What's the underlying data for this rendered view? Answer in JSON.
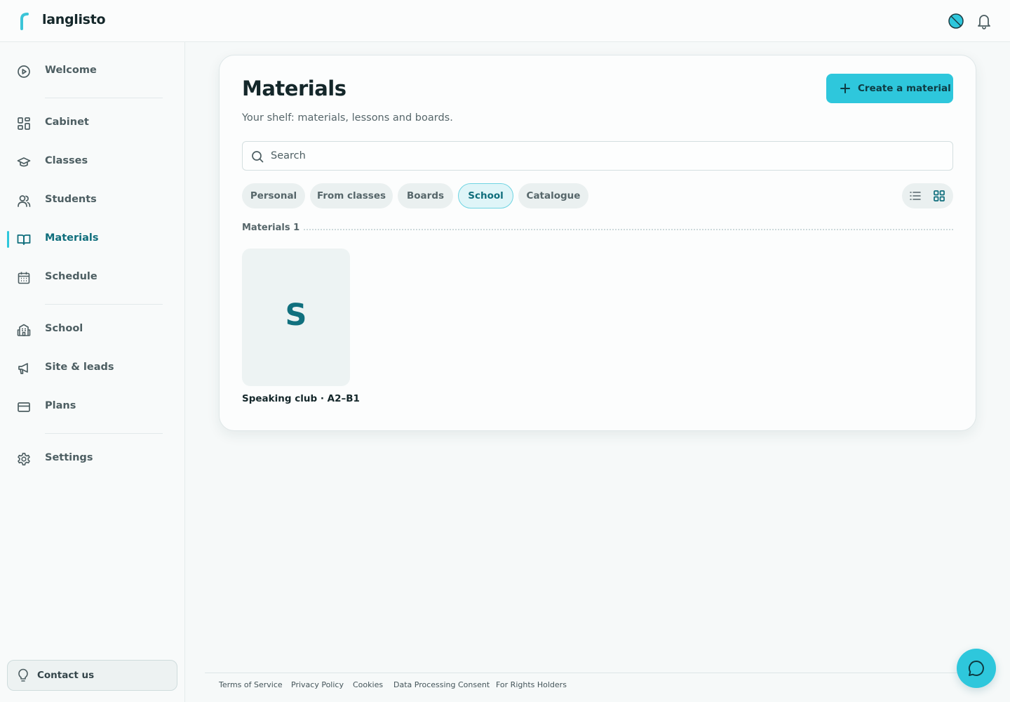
{
  "app": {
    "name": "langlisto"
  },
  "header": {
    "theme_icon": "theme-toggle-icon",
    "notifications_icon": "bell-icon"
  },
  "sidebar": {
    "items": [
      {
        "label": "Welcome",
        "icon": "play-circle-icon"
      },
      {
        "label": "Cabinet",
        "icon": "dashboard-grid-icon"
      },
      {
        "label": "Classes",
        "icon": "graduation-cap-icon"
      },
      {
        "label": "Students",
        "icon": "users-icon"
      },
      {
        "label": "Materials",
        "icon": "book-open-icon",
        "active": true
      },
      {
        "label": "Schedule",
        "icon": "calendar-icon"
      },
      {
        "label": "School",
        "icon": "school-building-icon"
      },
      {
        "label": "Site & leads",
        "icon": "megaphone-icon"
      },
      {
        "label": "Plans",
        "icon": "credit-card-icon"
      },
      {
        "label": "Settings",
        "icon": "gear-icon"
      }
    ],
    "contact_label": "Contact us"
  },
  "main": {
    "title": "Materials",
    "subtitle": "Your shelf: materials, lessons and boards.",
    "create_label": "Create a material",
    "search": {
      "placeholder": "Search",
      "value": ""
    },
    "filters": [
      {
        "label": "Personal",
        "active": false
      },
      {
        "label": "From classes",
        "active": false
      },
      {
        "label": "Boards",
        "active": false
      },
      {
        "label": "School",
        "active": true
      },
      {
        "label": "Catalogue",
        "active": false
      }
    ],
    "view_mode": "grid",
    "section_label": "Materials 1",
    "materials": [
      {
        "letter": "S",
        "title": "Speaking club · A2–B1"
      }
    ]
  },
  "footer": {
    "links": [
      "Terms of Service",
      "Privacy Policy",
      "Cookies",
      "Data Processing Consent",
      "For Rights Holders"
    ]
  },
  "colors": {
    "accent": "#2ec7dc",
    "accent_dark": "#0f6e7c"
  }
}
